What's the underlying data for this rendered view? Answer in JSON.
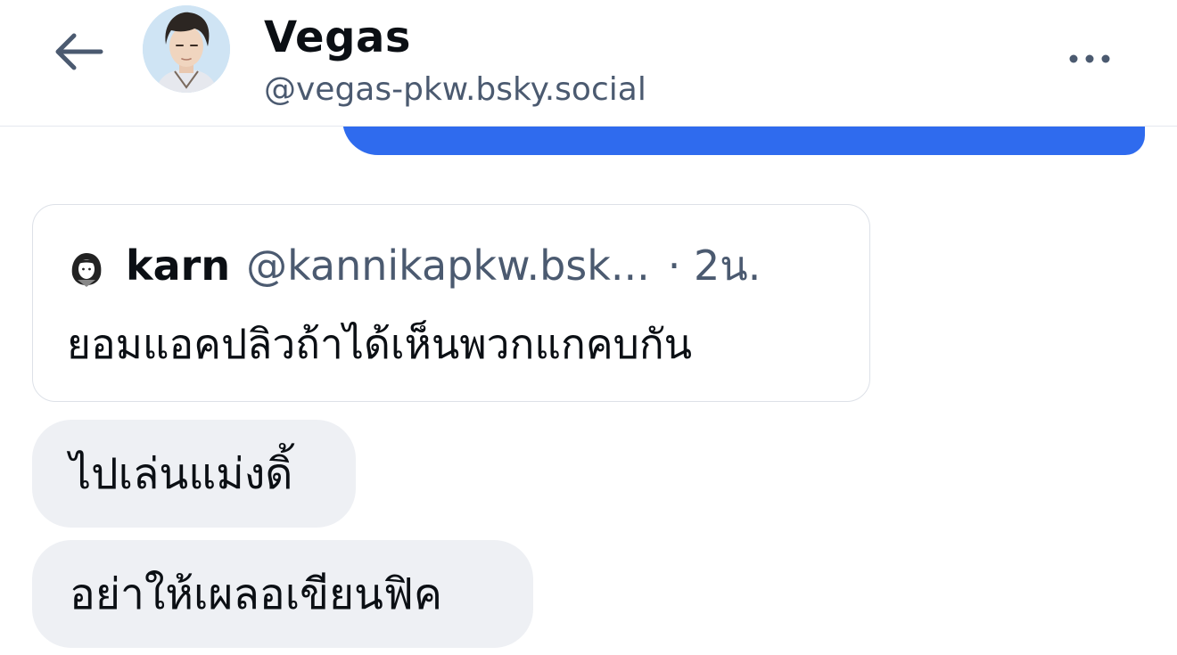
{
  "header": {
    "title": "Vegas",
    "handle": "@vegas-pkw.bsky.social",
    "back_icon": "arrow-left-icon",
    "more_icon": "ellipsis-icon"
  },
  "quote": {
    "name": "karn",
    "handle": "@kannikapkw.bsk...",
    "time": "· 2น.",
    "text": "ยอมแอคปลิวถ้าได้เห็นพวกแกคบกัน"
  },
  "messages": [
    {
      "text": "ไปเล่นแม่งดิ้"
    },
    {
      "text": "อย่าให้เผลอเขียนฟิค"
    }
  ],
  "colors": {
    "accent": "#2f6bee",
    "bubble_bg": "#eef0f4",
    "text_primary": "#0b0f14",
    "text_secondary": "#4b5a70"
  }
}
